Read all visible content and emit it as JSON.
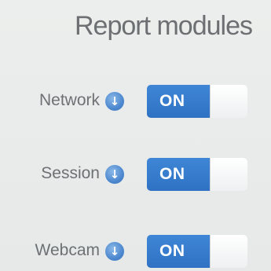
{
  "panel": {
    "title": "Report modules"
  },
  "modules": [
    {
      "label": "Network",
      "info_icon": "info-icon",
      "toggle_label": "ON",
      "enabled": true
    },
    {
      "label": "Session",
      "info_icon": "info-icon",
      "toggle_label": "ON",
      "enabled": true
    },
    {
      "label": "Webcam",
      "info_icon": "info-icon",
      "toggle_label": "ON",
      "enabled": true
    }
  ],
  "colors": {
    "accent": "#2f72c4",
    "text": "#6e7174",
    "background": "#e9eceb"
  }
}
